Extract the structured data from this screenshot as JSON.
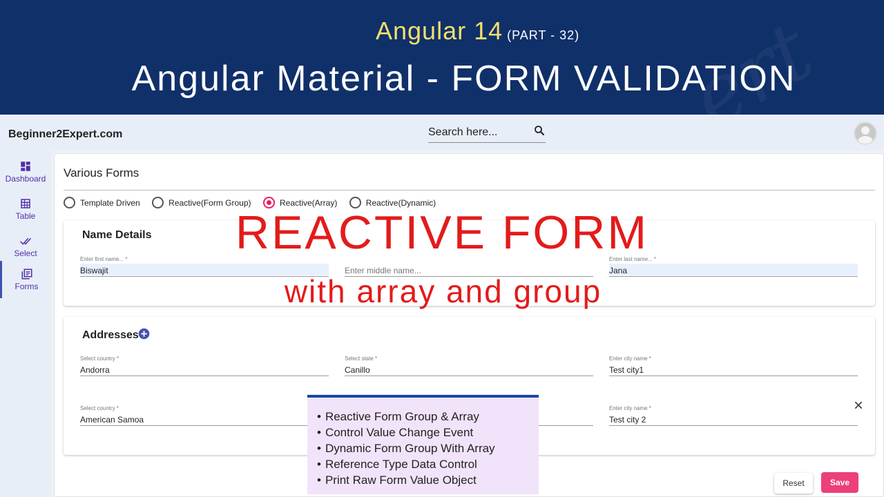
{
  "banner": {
    "title_main": "Angular 14",
    "title_part": "(PART - 32)",
    "subtitle": "Angular Material - FORM VALIDATION"
  },
  "appbar": {
    "brand": "Beginner2Expert.com",
    "search_placeholder": "Search here..."
  },
  "sidenav": {
    "items": [
      {
        "label": "Dashboard",
        "icon": "dashboard-icon"
      },
      {
        "label": "Table",
        "icon": "table-icon"
      },
      {
        "label": "Select",
        "icon": "done-all-icon"
      },
      {
        "label": "Forms",
        "icon": "library-books-icon",
        "active": true
      }
    ]
  },
  "main": {
    "title": "Various Forms",
    "radios": [
      {
        "label": "Template Driven",
        "checked": false
      },
      {
        "label": "Reactive(Form Group)",
        "checked": false
      },
      {
        "label": "Reactive(Array)",
        "checked": true
      },
      {
        "label": "Reactive(Dynamic)",
        "checked": false
      }
    ],
    "name_details": {
      "title": "Name Details",
      "first_name": {
        "label": "Enter first name... *",
        "value": "Biswajit"
      },
      "middle_name": {
        "placeholder": "Enter middle name..."
      },
      "last_name": {
        "label": "Enter last name... *",
        "value": "Jana"
      }
    },
    "addresses": {
      "title": "Addresses",
      "rows": [
        {
          "country": {
            "label": "Select country *",
            "value": "Andorra"
          },
          "state": {
            "label": "Select state *",
            "value": "Canillo"
          },
          "city": {
            "label": "Enter city name *",
            "value": "Test city1"
          }
        },
        {
          "country": {
            "label": "Select country *",
            "value": "American Samoa"
          },
          "city": {
            "label": "Enter city name *",
            "value": "Test city 2"
          }
        }
      ]
    },
    "buttons": {
      "reset": "Reset",
      "save": "Save"
    }
  },
  "overlay": {
    "headline": "REACTIVE FORM",
    "subline": "with array and group",
    "bullets": [
      "Reactive Form Group & Array",
      "Control Value Change Event",
      "Dynamic Form Group With Array",
      "Reference Type Data Control",
      "Print Raw Form Value Object"
    ]
  },
  "colors": {
    "banner_bg": "#10306a",
    "banner_accent": "#f2e06b",
    "overlay_red": "#e31b1b",
    "save_pink": "#ec407a",
    "nav_purple": "#512da8"
  }
}
